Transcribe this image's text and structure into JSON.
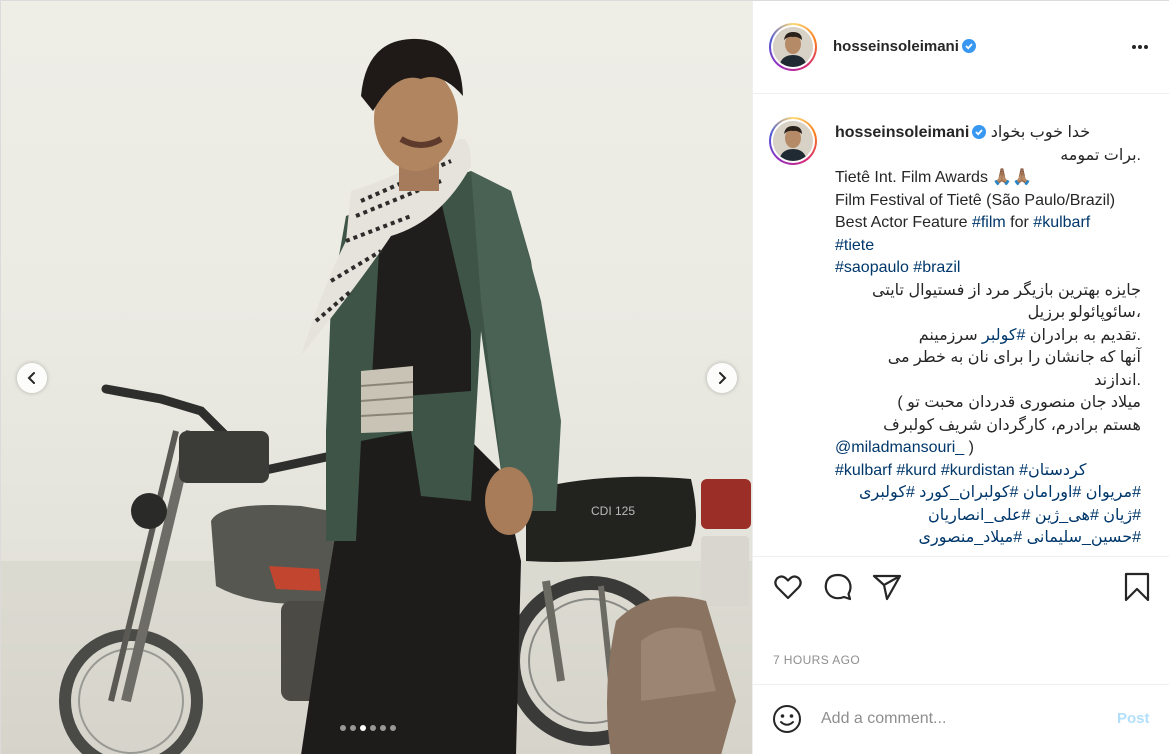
{
  "post": {
    "username": "hosseinsoleimani",
    "verified": true,
    "more_icon": "more-horizontal-icon",
    "carousel": {
      "slide_count": 6,
      "active_slide": 3,
      "prev_icon": "chevron-left-icon",
      "next_icon": "chevron-right-icon"
    },
    "photo": {
      "scene": "man in green jacket and checkered scarf standing in front of a motorcycle"
    },
    "motorcycle_badge": "CDI 125"
  },
  "caption": {
    "username": "hosseinsoleimani",
    "lines": [
      {
        "text": "خدا خوب بخواد",
        "rtl": true,
        "first": true
      },
      {
        "text": ".برات تمومه",
        "rtl": true
      },
      {
        "text": "Tietê Int. Film Awards 🙏🏽🙏🏽",
        "rtl": false
      },
      {
        "text": "Film Festival of Tietê (São Paulo/Brazil)",
        "rtl": false
      },
      {
        "text_parts": [
          "Best Actor Feature ",
          "#film",
          " for ",
          "#kulbarf"
        ],
        "rtl": false
      },
      {
        "text_parts": [
          "#tiete"
        ],
        "rtl": false
      },
      {
        "text_parts": [
          "#saopaulo",
          " ",
          "#brazil"
        ],
        "rtl": false
      },
      {
        "text": "جایزه بهترین بازیگر مرد از فستیوال تایتی",
        "rtl": true
      },
      {
        "text": "،سائوپائولو برزیل",
        "rtl": true
      },
      {
        "text_parts": [
          ".تقدیم به برادران ",
          "#کولبر",
          " سرزمینم"
        ],
        "rtl": true
      },
      {
        "text": "آنها که جانشان را برای نان به خطر می",
        "rtl": true
      },
      {
        "text": ".اندازند",
        "rtl": true
      },
      {
        "text": "میلاد جان منصوری قدردان محبت تو )",
        "rtl": true
      },
      {
        "text": "هستم برادرم، کارگردان شریف کولبرف",
        "rtl": true
      },
      {
        "text_parts": [
          "@miladmansouri_",
          " )"
        ],
        "rtl": false
      },
      {
        "text_parts": [
          "#kulbarf",
          " ",
          "#kurd",
          " ",
          "#kurdistan",
          " ",
          "#کردستان"
        ],
        "rtl": false
      },
      {
        "text_parts": [
          "#مریوان",
          " ",
          "#اورامان",
          " ",
          "#کولبران_کورد",
          " ",
          "#کولبری"
        ],
        "rtl": true
      },
      {
        "text_parts": [
          "#ژیان",
          " ",
          "#هی_ژین",
          " ",
          "#علی_انصاریان"
        ],
        "rtl": true
      },
      {
        "text_parts": [
          "#حسین_سلیمانی",
          " ",
          "#میلاد_منصوری"
        ],
        "rtl": true
      }
    ]
  },
  "actions": {
    "like_icon": "heart-icon",
    "comment_icon": "comment-bubble-icon",
    "share_icon": "paper-plane-icon",
    "save_icon": "bookmark-icon"
  },
  "timestamp": "7 HOURS AGO",
  "comment_box": {
    "emoji_icon": "smiley-icon",
    "placeholder": "Add a comment...",
    "post_label": "Post"
  },
  "colors": {
    "hashtag": "#00376b",
    "verified_badge": "#3897f0",
    "post_button_disabled": "#b2dffc",
    "muted_text": "#8e8e8e"
  }
}
